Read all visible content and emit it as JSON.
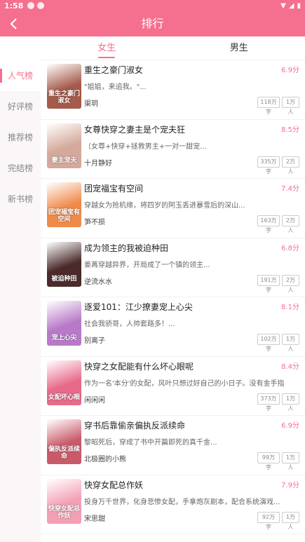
{
  "status_bar": {
    "time": "1:58"
  },
  "header": {
    "title": "排行"
  },
  "gender_tabs": [
    "女生",
    "男生"
  ],
  "sidebar": [
    "人气榜",
    "好评榜",
    "推荐榜",
    "完结榜",
    "新书榜"
  ],
  "books": [
    {
      "title": "重生之豪门淑女",
      "score": "6.9分",
      "intro": "\"姐姐，来追我。\"...",
      "author": "渠玥",
      "words": "118万字",
      "readers": "1万人",
      "cover_text": "重生之豪门淑女",
      "cover_color": "#a55a4a"
    },
    {
      "title": "女尊快穿之妻主是个宠夫狂",
      "score": "8.5分",
      "intro": "（女尊+快穿+拯救男主+一对一甜宠...",
      "author": "十月静好",
      "words": "335万字",
      "readers": "2万人",
      "cover_text": "妻主宠夫",
      "cover_color": "#d4a89a"
    },
    {
      "title": "团宠福宝有空间",
      "score": "7.4分",
      "intro": "穿越女为抢机缘，将四岁的阿玉丢进暴雪后的深山...",
      "author": "笋不损",
      "words": "163万字",
      "readers": "2万人",
      "cover_text": "团宠福宝有空间",
      "cover_color": "#f08a4b"
    },
    {
      "title": "成为领主的我被迫种田",
      "score": "6.8分",
      "intro": "姜苒穿越异界，开局成了一个镇的领主...",
      "author": "逆流水水",
      "words": "191万字",
      "readers": "2万人",
      "cover_text": "被迫种田",
      "cover_color": "#4a2a2a"
    },
    {
      "title": "逐爱101：江少撩妻宠上心尖",
      "score": "8.1分",
      "intro": "社会我骄哥，人帅套路多！...",
      "author": "别离子",
      "words": "102万字",
      "readers": "1万人",
      "cover_text": "宠上心尖",
      "cover_color": "#b87ac8"
    },
    {
      "title": "快穿之女配能有什么坏心眼呢",
      "score": "8.4分",
      "intro": "作为一名'本分'的女配，风叶只想过好自己的小日子。没有金手指",
      "author": "闲闲闲",
      "words": "373万字",
      "readers": "1万人",
      "cover_text": "女配坏心眼",
      "cover_color": "#e86a8a"
    },
    {
      "title": "穿书后靠偷亲偏执反派续命",
      "score": "6.9分",
      "intro": "黎昭死后，穿成了书中开篇即死的真千金...",
      "author": "北极圈的小熊",
      "words": "99万字",
      "readers": "1万人",
      "cover_text": "偏执反派续命",
      "cover_color": "#c95a6a"
    },
    {
      "title": "快穿女配总作妖",
      "score": "7.9分",
      "intro": "投身万千世界，化身悲惨女配，手拿炮灰剧本，配合系统演戏...",
      "author": "宋思甜",
      "words": "92万字",
      "readers": "1万人",
      "cover_text": "快穿女配总作妖",
      "cover_color": "#f2a0b4"
    }
  ],
  "colors": {
    "accent": "#f56f8e"
  }
}
